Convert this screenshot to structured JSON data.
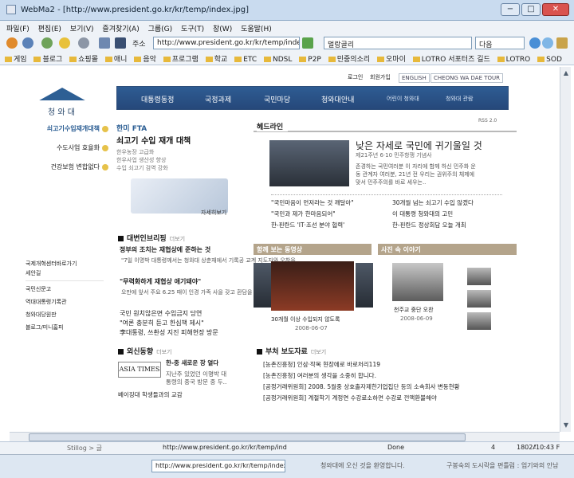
{
  "window": {
    "title": "WebMa2 - [http://www.president.go.kr/kr/temp/index.jpg]",
    "controls": [
      "−",
      "□",
      "✕"
    ]
  },
  "menu": [
    "파일(F)",
    "편집(E)",
    "보기(V)",
    "즐겨찾기(A)",
    "그룹(G)",
    "도구(T)",
    "창(W)",
    "도움말(H)"
  ],
  "toolbar": {
    "address_label": "주소",
    "address_value": "http://www.president.go.kr/kr/temp/index.jpg",
    "search_value": "멀랑골리",
    "search_engine": "다음"
  },
  "favorites": [
    "게임",
    "블로그",
    "쇼핑몰",
    "애니",
    "음악",
    "프로그램",
    "학교",
    "ETC",
    "NDSL",
    "P2P",
    "민중의소리",
    "오마이",
    "LOTRO 서포터즈 길드",
    "LOTRO",
    "SOD"
  ],
  "site": {
    "logo_text": "청 와 대",
    "util_links": [
      "로그인",
      "회원가입"
    ],
    "util_buttons": [
      "ENGLISH",
      "CHEONG WA DAE TOUR"
    ],
    "nav_tabs": [
      "대통령동정",
      "국정과제",
      "국민마당",
      "청와대안내"
    ],
    "nav_sub": [
      "어린이 청와대",
      "청와대 관람"
    ],
    "side_nav": [
      "쇠고기수입재개대책",
      "수도사업 효율화",
      "건강보험 변합없다"
    ],
    "side_links": [
      "국제개혁센터바로가기",
      "세안길",
      "국민신문고",
      "역대대통령기록관",
      "청와대당원판",
      "블로그/미니홈피"
    ],
    "promo": {
      "header": "한미 FTA",
      "title": "쇠고기 수입 재개 대책",
      "sub": [
        "한우농장 고급화",
        "한우사업 생산성 향상",
        "수입 쇠고기 검역 강화"
      ],
      "more": "자세히보기"
    },
    "briefing": {
      "title": "대변인브리핑",
      "more": "더보기",
      "items": [
        "정부의 조치는 재협상에 준하는 것",
        "\"7일 이명박 대통령께서는 청와대 상춘재에서 기록공 교계 지도자와 오찬을...",
        "\"무력화하게 재협상 애기돼야\"",
        "오만에 앞서 주요 6.25 때이 인경 가족 사을 갖고 환담을 많이 하셨다...",
        "국민 원치않은면 수입금지 당연",
        "\"여론 충분히 듣고 한심책 제시\"",
        "李대통령, 쓰촨성 지진 피해현장 방문"
      ]
    },
    "headline": {
      "section": "헤드라인",
      "rss": "RSS 2.0",
      "title": "낮은 자세로 국민에 귀기울일 것",
      "date": "제21주년 6·10 민주항쟁 기념사",
      "body": [
        "존경하는 국민여러분 이 자리에 함께 하신 민주화 운",
        "동 관계자 여러분, 21년 전 우리는 권위주의 체제에",
        "맞서 민주주의를 바로 세우는.."
      ],
      "list_left": [
        "\"국민마음이 먼저라는 것 깨달아\"",
        "\"국민과 제가 한마음되어\"",
        "한-핀란드 'IT·조선 분야 협력'"
      ],
      "list_right": [
        "30개월 넘는 쇠고기 수입 않겠다",
        "이 대통령 청와대의 고민",
        "한-핀란드 정상회담 오늘 개최"
      ]
    },
    "video": {
      "section": "함께 보는 동영상",
      "caption": "30개월 이상 수입되지 않도록",
      "date": "2008-06-07"
    },
    "photo": {
      "section": "사진 속 이야기",
      "caption": "천주교 중단 오찬",
      "date": "2008-06-09"
    },
    "abroad": {
      "title": "외신동향",
      "more": "더보기",
      "logo": "ASIA TIMES",
      "headline": "한-중 새로운 장 열다",
      "desc": [
        "지난주 있었던 이명박 대",
        "통령의 중국 방문 중 두.."
      ],
      "items": [
        "베이징대 학생들과의 교감"
      ]
    },
    "press": {
      "title": "부처 보도자료",
      "more": "더보기",
      "items": [
        "[농촌진흥청] 인삼·작목 현장에로 바로처리119",
        "[농촌진흥청] 여러분의 생각을 소중히 합니다.",
        "[공정거래위원회] 2008. 5월중 상호출자제한기업집단 등의 소속회사 변동현황",
        "[공정거래위원회] 계절학기 계정연 수강료소하면 수강료 전액환불해야"
      ]
    }
  },
  "status": {
    "left": "Stillog > 글",
    "url": "http://www.president.go.kr/kr/temp/index.jpg",
    "done": "Done",
    "count": "4",
    "res": "1802A",
    "time": "10:43 F"
  },
  "taskbar": {
    "welcome": "청와대에 오신 것을 환영합니다.",
    "ticker": "구봉숙의 도시락을 편틀럼 : 업기와의 안남"
  }
}
